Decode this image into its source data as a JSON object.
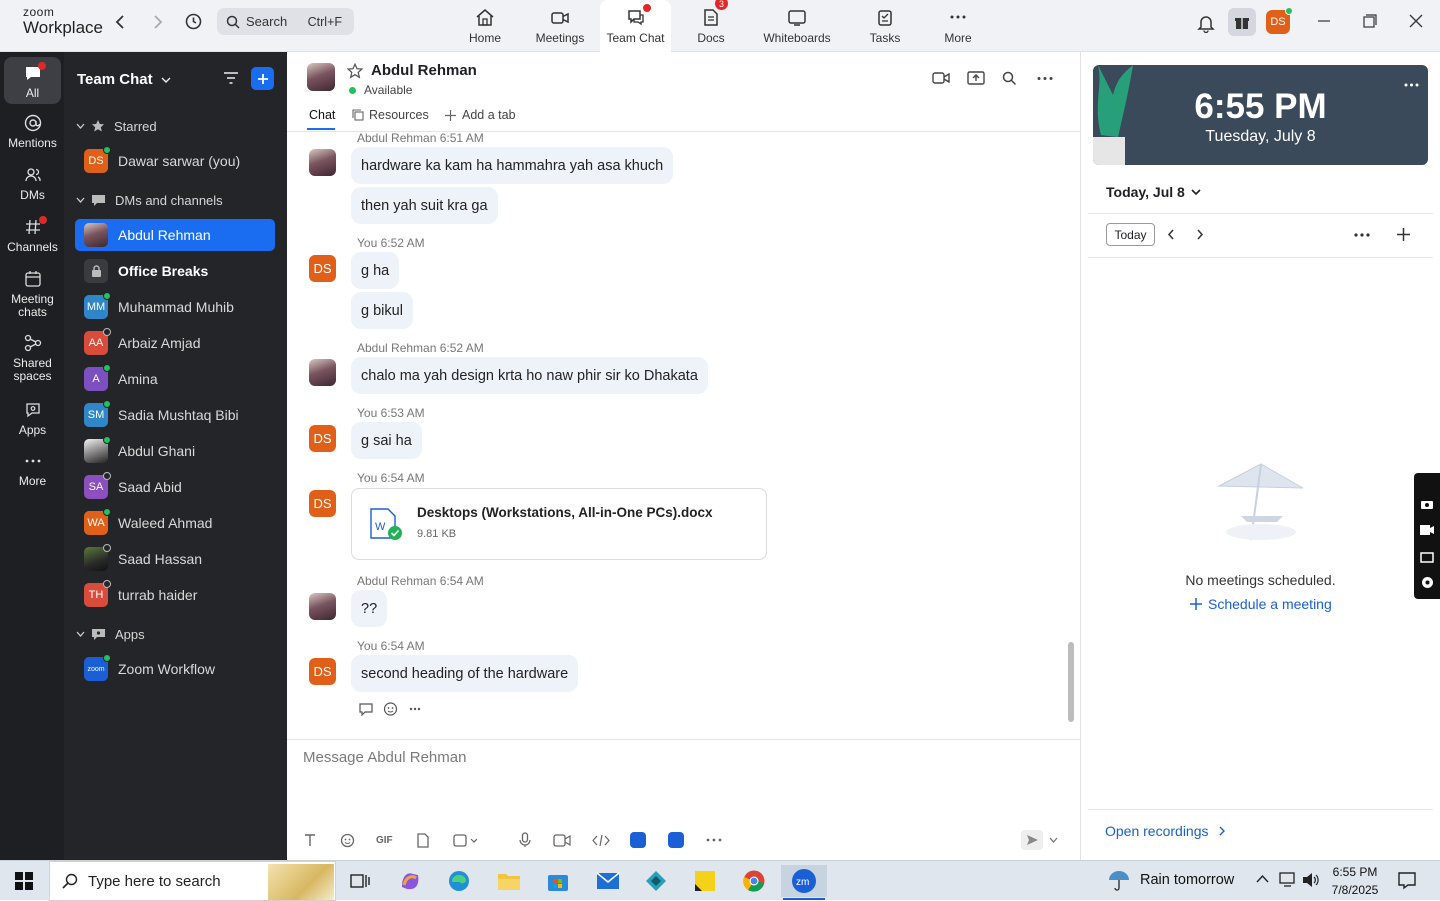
{
  "app": {
    "logo_top": "zoom",
    "logo_bottom": "Workplace"
  },
  "search": {
    "label": "Search",
    "shortcut": "Ctrl+F"
  },
  "nav": [
    {
      "label": "Home"
    },
    {
      "label": "Meetings"
    },
    {
      "label": "Team Chat"
    },
    {
      "label": "Docs",
      "badge": "3"
    },
    {
      "label": "Whiteboards"
    },
    {
      "label": "Tasks"
    },
    {
      "label": "More"
    }
  ],
  "profile": {
    "initials": "DS"
  },
  "rail": [
    {
      "label": "All"
    },
    {
      "label": "Mentions"
    },
    {
      "label": "DMs"
    },
    {
      "label": "Channels"
    },
    {
      "label": "Meeting chats"
    },
    {
      "label": "Shared spaces"
    },
    {
      "label": "Apps"
    },
    {
      "label": "More"
    }
  ],
  "sidebar": {
    "title": "Team Chat",
    "sections": {
      "starred": "Starred",
      "dms": "DMs and channels",
      "apps": "Apps"
    },
    "starred": [
      {
        "name": "Dawar sarwar (you)",
        "initials": "DS",
        "color": "#e0601a"
      }
    ],
    "items": [
      {
        "name": "Abdul Rehman",
        "initials": "",
        "color": "photo"
      },
      {
        "name": "Office Breaks",
        "initials": "",
        "color": "#3a3b3f"
      },
      {
        "name": "Muhammad Muhib",
        "initials": "MM",
        "color": "#2f86c9"
      },
      {
        "name": "Arbaiz Amjad",
        "initials": "AA",
        "color": "#d94b3a"
      },
      {
        "name": "Amina",
        "initials": "A",
        "color": "#7e4fc0"
      },
      {
        "name": "Sadia Mushtaq Bibi",
        "initials": "SM",
        "color": "#2f86c9"
      },
      {
        "name": "Abdul Ghani",
        "initials": "",
        "color": "photo"
      },
      {
        "name": "Saad Abid",
        "initials": "SA",
        "color": "#8b4fc0"
      },
      {
        "name": "Waleed Ahmad",
        "initials": "WA",
        "color": "#e0601a"
      },
      {
        "name": "Saad Hassan",
        "initials": "",
        "color": "photo"
      },
      {
        "name": "turrab haider",
        "initials": "TH",
        "color": "#d94b3a"
      }
    ],
    "apps": [
      {
        "name": "Zoom Workflow",
        "initials": "zoom",
        "color": "#1a5fd6"
      }
    ]
  },
  "chat": {
    "contact": "Abdul Rehman",
    "status": "Available",
    "tabs": {
      "chat": "Chat",
      "resources": "Resources",
      "add": "Add a tab"
    },
    "messages": [
      {
        "meta": "Abdul Rehman 6:51 AM",
        "bubbles": [
          "hardware ka kam ha hammahra yah asa khuch",
          "then yah suit kra ga"
        ]
      },
      {
        "meta": "You 6:52 AM",
        "bubbles": [
          "g ha",
          "g bikul"
        ]
      },
      {
        "meta": "Abdul Rehman 6:52 AM",
        "bubbles": [
          "chalo ma yah design krta ho naw phir sir ko Dhakata"
        ]
      },
      {
        "meta": "You 6:53 AM",
        "bubbles": [
          "g sai ha"
        ]
      },
      {
        "meta": "You 6:54 AM",
        "file": {
          "name": "Desktops (Workstations, All-in-One PCs).docx",
          "size": "9.81 KB"
        }
      },
      {
        "meta": "Abdul Rehman 6:54 AM",
        "bubbles": [
          "??"
        ]
      },
      {
        "meta": "You 6:54 AM",
        "bubbles": [
          "second heading of the hardware"
        ]
      }
    ],
    "placeholder": "Message Abdul Rehman"
  },
  "right": {
    "time": "6:55 PM",
    "date": "Tuesday, July 8",
    "day_select": "Today, Jul 8",
    "today_btn": "Today",
    "empty": "No meetings scheduled.",
    "schedule": "Schedule a meeting",
    "recordings": "Open recordings"
  },
  "taskbar": {
    "search_placeholder": "Type here to search",
    "weather": "Rain tomorrow",
    "clock_time": "6:55 PM",
    "clock_date": "7/8/2025"
  }
}
